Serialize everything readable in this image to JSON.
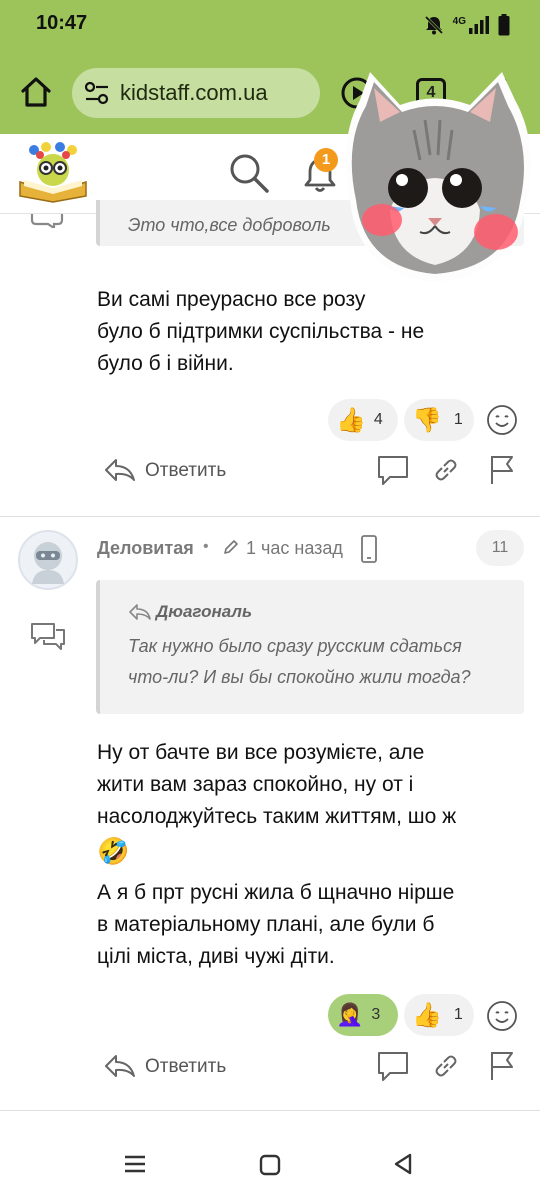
{
  "status_bar": {
    "time": "10:47",
    "network": "4G"
  },
  "browser": {
    "url": "kidstaff.com.ua",
    "tabs_count": "4"
  },
  "site_header": {
    "notifications_count": "1"
  },
  "comment1": {
    "quote_text": "Это что,все доброволь",
    "body_lines": [
      "Ви самі преурасно все розу",
      "було б підтримки суспільства - не",
      "було б і війни."
    ],
    "reactions": [
      {
        "emoji": "👍",
        "count": "4"
      },
      {
        "emoji": "👎",
        "count": "1"
      }
    ],
    "reply_label": "Ответить"
  },
  "comment2": {
    "author": "Деловитая",
    "separator": "•",
    "time": "1 час назад",
    "number": "11",
    "quote_author": "Дюагональ",
    "quote_lines": [
      "Так нужно было сразу русским сдаться",
      "что-ли? И вы бы спокойно жили тогда?"
    ],
    "body_lines": [
      "Ну от бачте ви все розумієте, але",
      "жити вам зараз спокойно, ну от і",
      "насолоджуйтесь таким життям, шо ж"
    ],
    "body_emoji": "🤣",
    "body_lines_2": [
      "А я б прт русні жила б щначно нірше",
      "в матеріальному плані, але були б",
      "цілі міста, диві чужі діти."
    ],
    "reactions": [
      {
        "emoji": "🤦‍♀️",
        "count": "3"
      },
      {
        "emoji": "👍",
        "count": "1"
      }
    ],
    "reply_label": "Ответить"
  },
  "colors": {
    "browser_green": "#9cc45a",
    "url_pill": "#c6dea0",
    "badge_orange": "#f39a1d",
    "reaction_active": "#a8d07a"
  }
}
